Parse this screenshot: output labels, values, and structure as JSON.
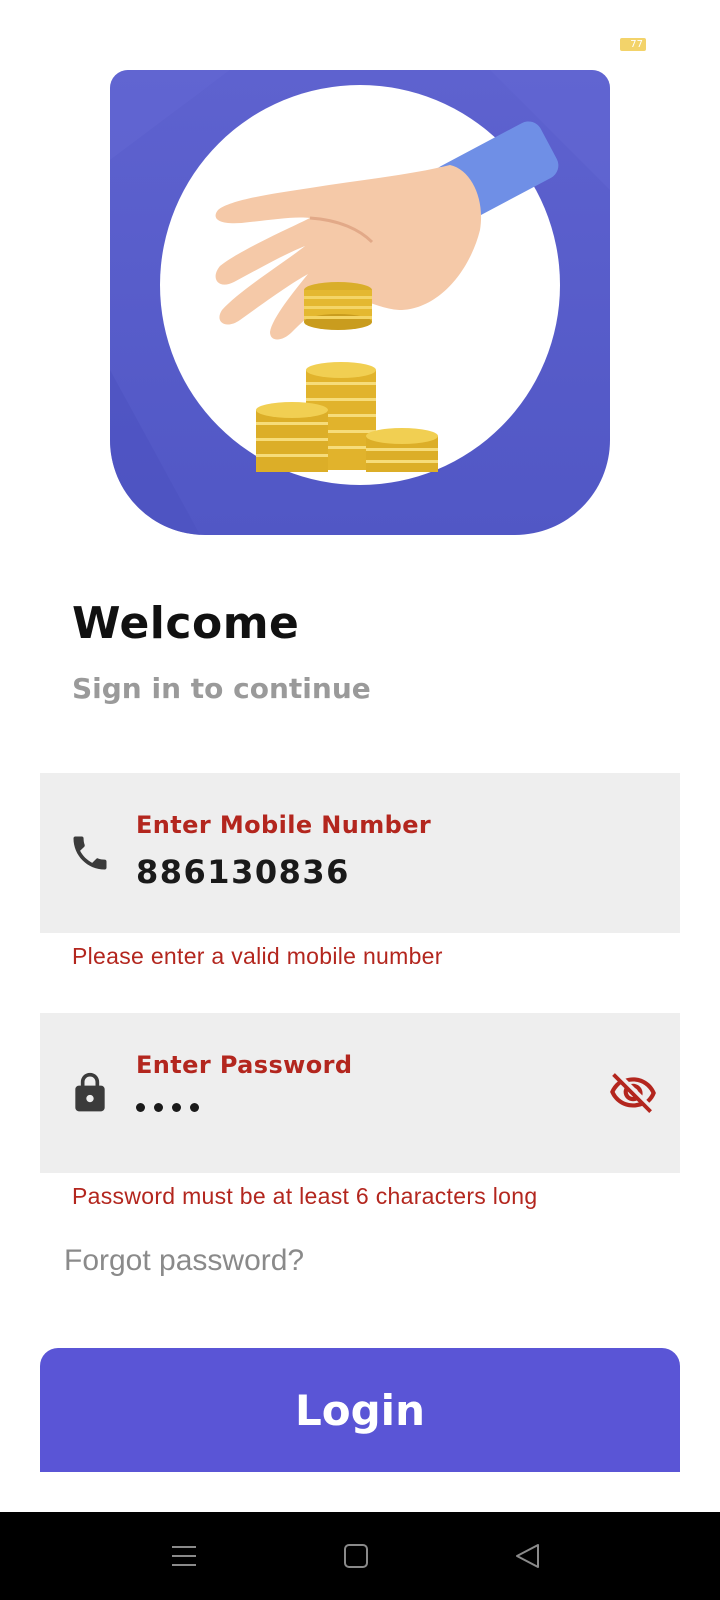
{
  "status_bar": {
    "battery_level": "77"
  },
  "header": {
    "title": "Welcome",
    "subtitle": "Sign in to continue"
  },
  "mobile_field": {
    "label": "Enter Mobile Number",
    "value": "886130836",
    "error": "Please enter a valid mobile number",
    "icon": "phone-icon"
  },
  "password_field": {
    "label": "Enter Password",
    "masked_length": 4,
    "error": "Password must be at least 6 characters long",
    "icon": "lock-icon",
    "toggle_icon": "eye-off-icon"
  },
  "forgot_password_label": "Forgot password?",
  "login_label": "Login",
  "colors": {
    "primary": "#5a55d6",
    "error": "#b3261e",
    "field_background": "#eeeeee"
  },
  "navigation_bar": {
    "icons": [
      "menu-icon",
      "home-square-icon",
      "back-triangle-icon"
    ]
  }
}
